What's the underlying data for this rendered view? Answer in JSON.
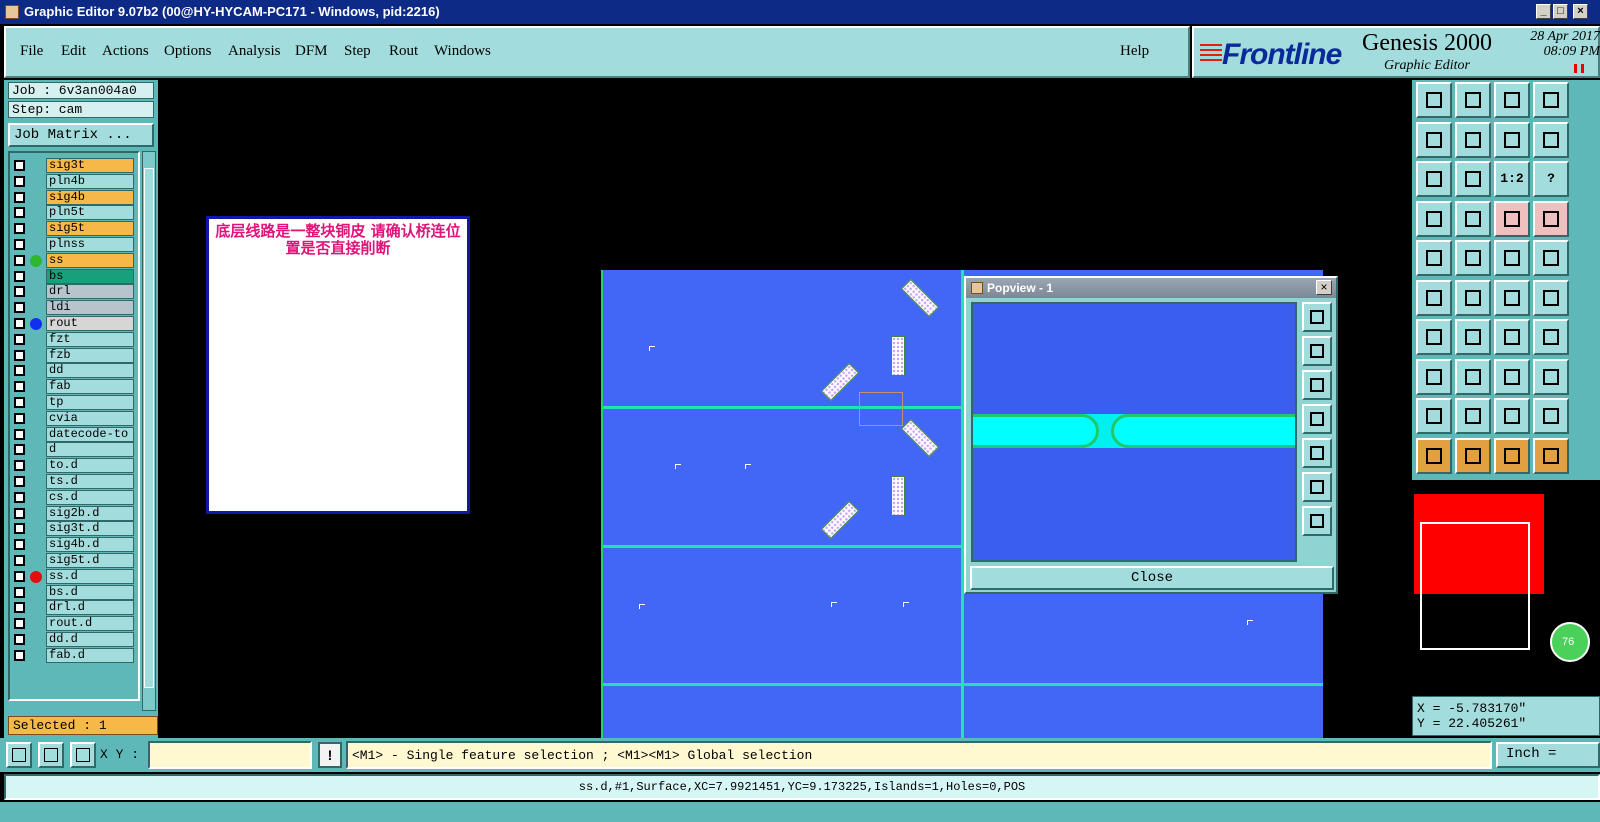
{
  "window": {
    "title": "Graphic Editor 9.07b2 (00@HY-HYCAM-PC171 - Windows, pid:2216)",
    "minimize": "_",
    "maximize": "□",
    "close": "×"
  },
  "menu": {
    "items": [
      "File",
      "Edit",
      "Actions",
      "Options",
      "Analysis",
      "DFM",
      "Step",
      "Rout",
      "Windows"
    ],
    "help": "Help"
  },
  "brand": {
    "logo": "Frontline",
    "product": "Genesis 2000",
    "subtitle": "Graphic Editor",
    "date": "28 Apr 2017",
    "time": "08:09 PM"
  },
  "job": {
    "job_line": "Job : 6v3an004a0",
    "step_line": "Step: cam",
    "matrix_button": "Job Matrix ..."
  },
  "layers": [
    {
      "name": "sig3t",
      "color": "#f7b84a",
      "mark": ""
    },
    {
      "name": "pln4b",
      "color": "#a3dcdc",
      "mark": ""
    },
    {
      "name": "sig4b",
      "color": "#f7b84a",
      "mark": ""
    },
    {
      "name": "pln5t",
      "color": "#a3dcdc",
      "mark": ""
    },
    {
      "name": "sig5t",
      "color": "#f7b84a",
      "mark": ""
    },
    {
      "name": "plnss",
      "color": "#a3dcdc",
      "mark": ""
    },
    {
      "name": "ss",
      "color": "#f7b84a",
      "mark": "#2fb82f"
    },
    {
      "name": "bs",
      "color": "#17a07a",
      "mark": ""
    },
    {
      "name": "drl",
      "color": "#b8c4cc",
      "mark": ""
    },
    {
      "name": "ldi",
      "color": "#b8c4cc",
      "mark": ""
    },
    {
      "name": "rout",
      "color": "#d6d6d6",
      "mark": "#1030f0"
    },
    {
      "name": "fzt",
      "color": "#a3dcdc",
      "mark": ""
    },
    {
      "name": "fzb",
      "color": "#a3dcdc",
      "mark": ""
    },
    {
      "name": "dd",
      "color": "#a3dcdc",
      "mark": ""
    },
    {
      "name": "fab",
      "color": "#a3dcdc",
      "mark": ""
    },
    {
      "name": "tp",
      "color": "#a3dcdc",
      "mark": ""
    },
    {
      "name": "cvia",
      "color": "#a3dcdc",
      "mark": ""
    },
    {
      "name": "datecode-to",
      "color": "#a3dcdc",
      "mark": ""
    },
    {
      "name": "d",
      "color": "#a3dcdc",
      "mark": ""
    },
    {
      "name": "to.d",
      "color": "#a3dcdc",
      "mark": ""
    },
    {
      "name": "ts.d",
      "color": "#a3dcdc",
      "mark": ""
    },
    {
      "name": "cs.d",
      "color": "#a3dcdc",
      "mark": ""
    },
    {
      "name": "sig2b.d",
      "color": "#a3dcdc",
      "mark": ""
    },
    {
      "name": "sig3t.d",
      "color": "#a3dcdc",
      "mark": ""
    },
    {
      "name": "sig4b.d",
      "color": "#a3dcdc",
      "mark": ""
    },
    {
      "name": "sig5t.d",
      "color": "#a3dcdc",
      "mark": ""
    },
    {
      "name": "ss.d",
      "color": "#a3dcdc",
      "mark": "#e01010"
    },
    {
      "name": "bs.d",
      "color": "#a3dcdc",
      "mark": ""
    },
    {
      "name": "drl.d",
      "color": "#a3dcdc",
      "mark": ""
    },
    {
      "name": "rout.d",
      "color": "#a3dcdc",
      "mark": ""
    },
    {
      "name": "dd.d",
      "color": "#a3dcdc",
      "mark": ""
    },
    {
      "name": "fab.d",
      "color": "#a3dcdc",
      "mark": ""
    }
  ],
  "selected": "Selected : 1",
  "note": "底层线路是一整块铜皮   请确认桥连位置是否直接削断",
  "popview": {
    "title": "Popview - 1",
    "close": "Close",
    "close_x": "×"
  },
  "toolbox": {
    "ratio_label": "1:2",
    "help_label": "?"
  },
  "minimap": {
    "zoom_badge": "76"
  },
  "coords": {
    "x": "X = -5.783170\"",
    "y": "Y = 22.405261\""
  },
  "bottom": {
    "xy_label": "X Y :",
    "xy_value": "",
    "bang": "!",
    "prompt": "<M1> - Single feature selection ; <M1><M1> Global selection",
    "units": "Inch ="
  },
  "status": "ss.d,#1,Surface,XC=7.9921451,YC=9.173225,Islands=1,Holes=0,POS"
}
